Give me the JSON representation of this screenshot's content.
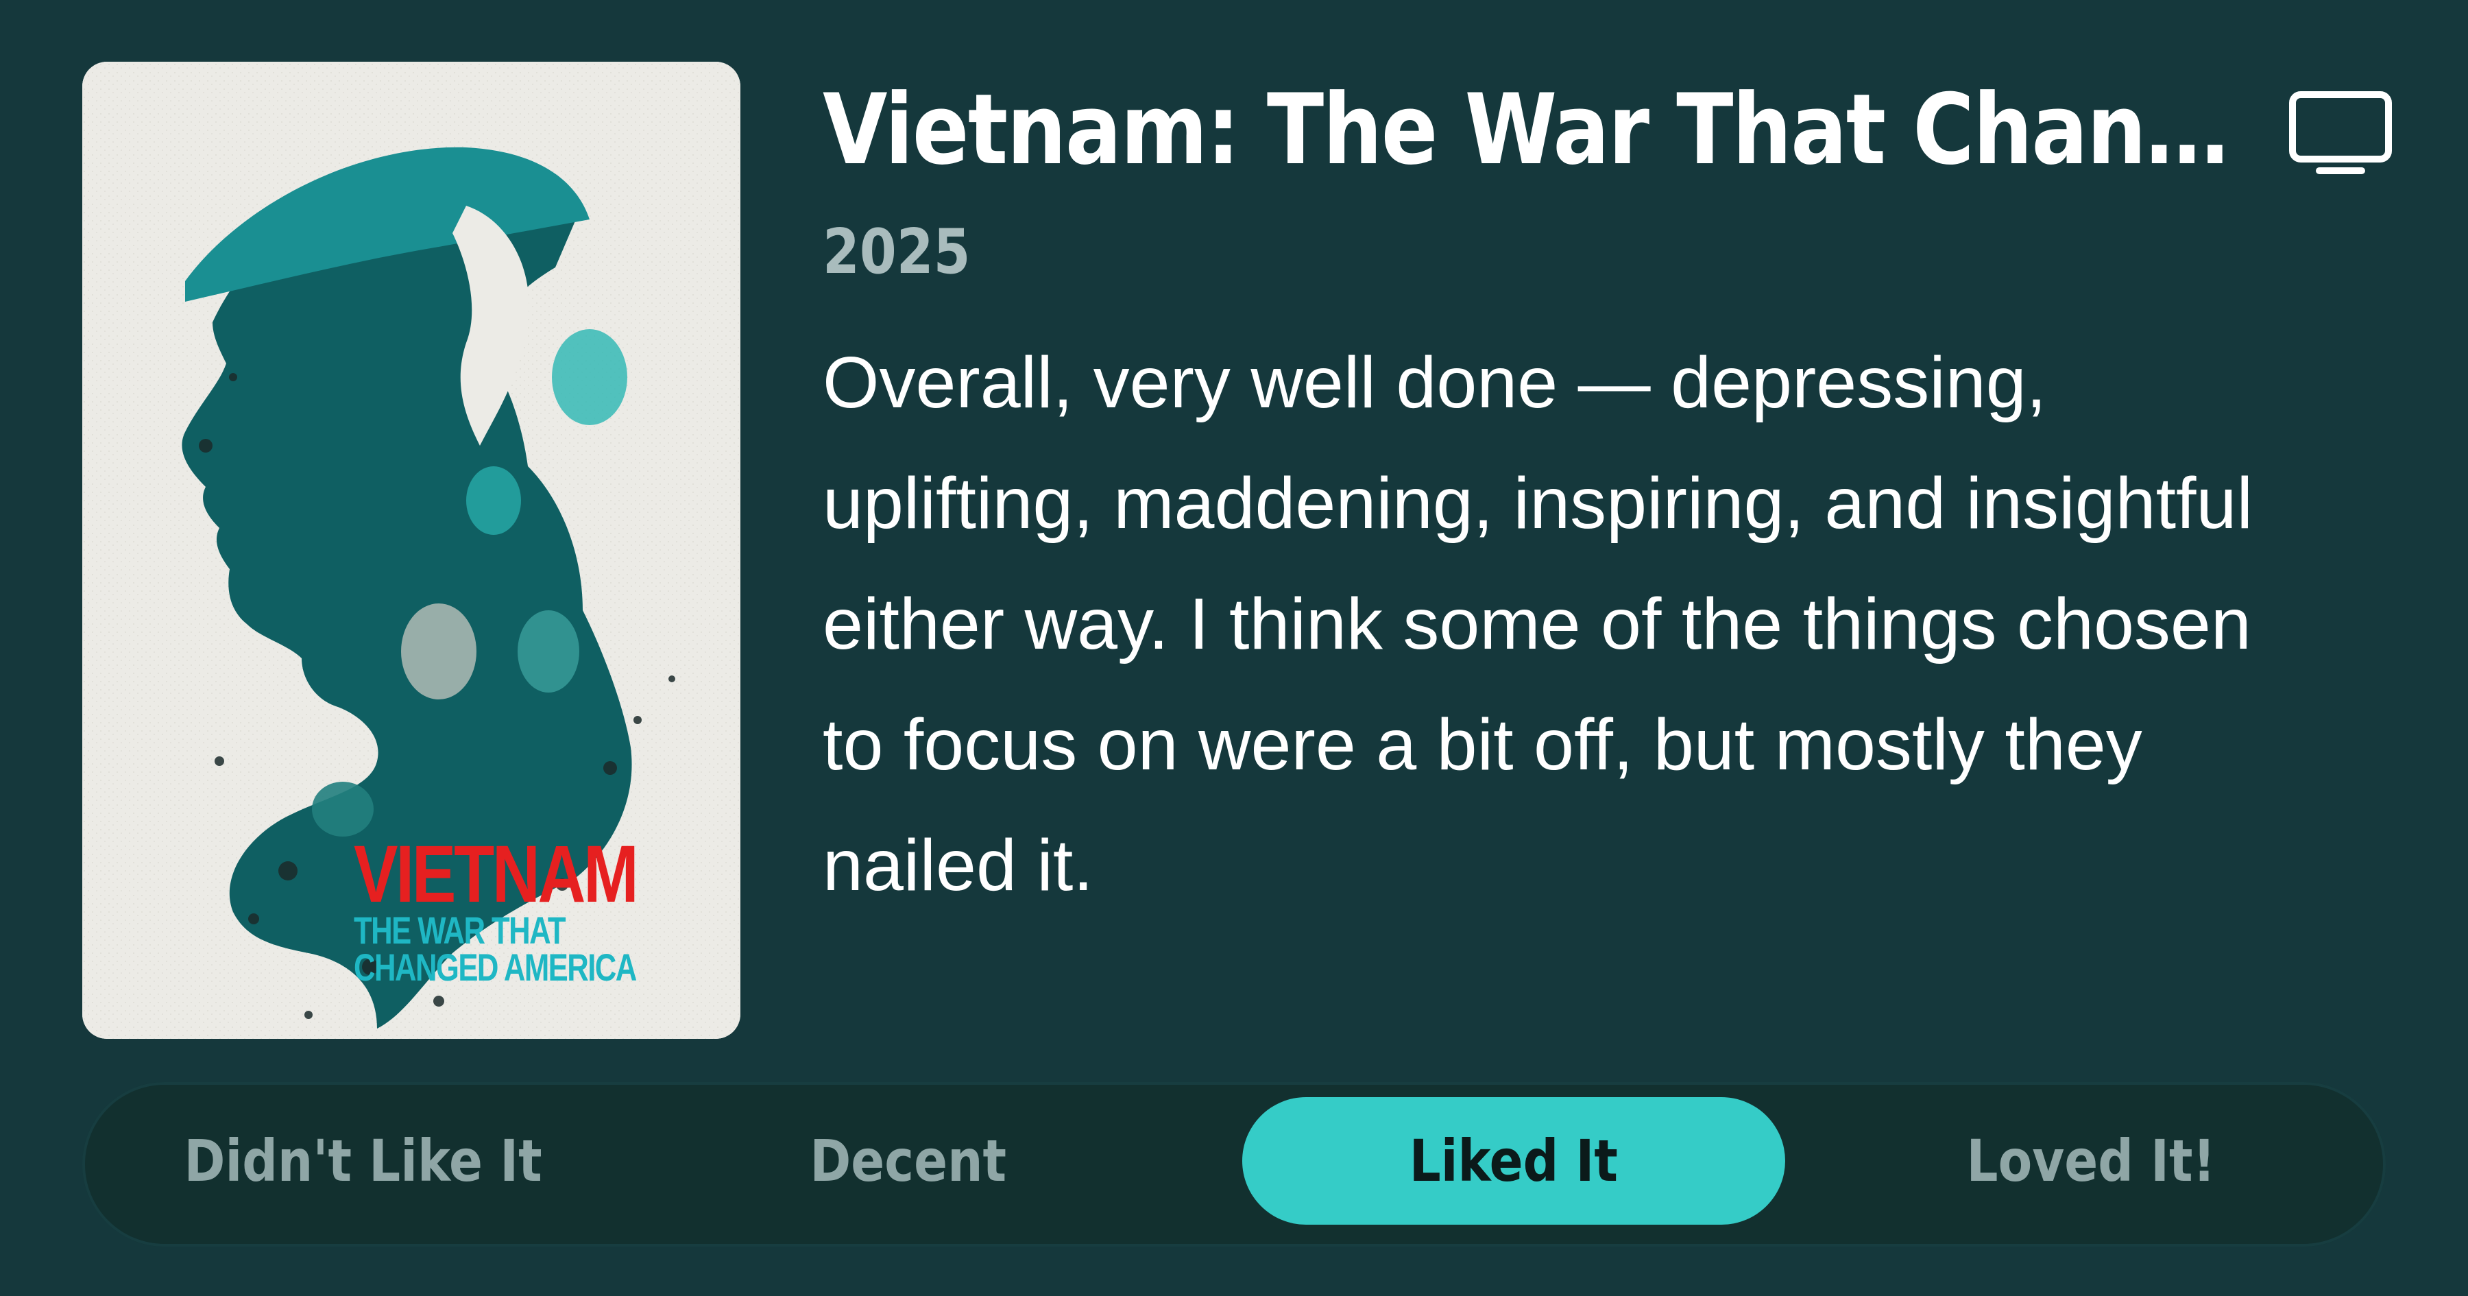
{
  "item": {
    "title": "Vietnam: The War That Chang...",
    "year": "2025",
    "review": "Overall, very well done — depressing, uplifting, maddening, inspiring, and insightful either way. I think some of the things chosen to focus on were a bit off, but mostly they nailed it.",
    "type_icon": "tv-icon"
  },
  "poster": {
    "title_line": "VIETNAM",
    "subtitle_line1": "THE WAR THAT",
    "subtitle_line2": "CHANGED AMERICA"
  },
  "rating": {
    "options": [
      {
        "label": "Didn't Like It",
        "selected": false
      },
      {
        "label": "Decent",
        "selected": false
      },
      {
        "label": "Liked It",
        "selected": true
      },
      {
        "label": "Loved It!",
        "selected": false
      }
    ]
  },
  "colors": {
    "background": "#15383c",
    "accent": "#35ccc7",
    "muted_text": "#8fa6a6",
    "poster_red": "#e62020",
    "poster_teal": "#1fb7c4"
  }
}
